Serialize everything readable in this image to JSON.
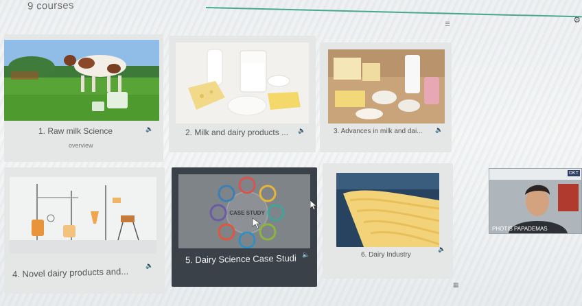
{
  "header": {
    "section_title": "9 courses"
  },
  "courses": [
    {
      "label": "1. Raw milk Science",
      "sub": "overview"
    },
    {
      "label": "2. Milk and dairy products ..."
    },
    {
      "label": "3. Advances in milk and dai..."
    },
    {
      "label": "4. Novel dairy products and..."
    },
    {
      "label": "5. Dairy Science Case Studi",
      "thumb_text": "CASE STUDY"
    },
    {
      "label": "6. Dairy Industry"
    }
  ],
  "video": {
    "name": "PHOTIS PAPADEMAS",
    "badge": "DKT"
  },
  "colors": {
    "accent": "#4aa78f",
    "active_card": "#3a4148",
    "card": "#e5e6e6"
  }
}
